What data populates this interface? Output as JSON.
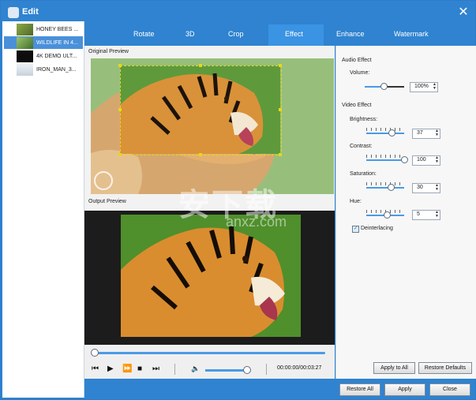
{
  "window": {
    "title": "Edit",
    "close_glyph": "✕"
  },
  "files": [
    {
      "name": "HONEY BEES ...",
      "thumb": "#6f8a3a",
      "selected": false
    },
    {
      "name": "WILDLIFE IN 4...",
      "thumb": "#77a24e",
      "selected": true
    },
    {
      "name": "4K DEMO ULT...",
      "thumb": "#0d0d0d",
      "selected": false
    },
    {
      "name": "IRON_MAN_3...",
      "thumb": "#d9e2ea",
      "selected": false
    }
  ],
  "tabs": [
    {
      "label": "Rotate"
    },
    {
      "label": "3D"
    },
    {
      "label": "Crop"
    },
    {
      "label": "Effect",
      "active": true
    },
    {
      "label": "Enhance"
    },
    {
      "label": "Watermark"
    }
  ],
  "preview": {
    "original_label": "Original Preview",
    "output_label": "Output Preview"
  },
  "playback": {
    "timecode": "00:00:00/00:03:27",
    "seek_progress": 0.01,
    "volume_level": 0.95
  },
  "audio_effect": {
    "heading": "Audio Effect",
    "volume_label": "Volume:",
    "volume_value": "100%",
    "volume_level": 0.5
  },
  "video_effect": {
    "heading": "Video Effect",
    "brightness": {
      "label": "Brightness:",
      "value": "37",
      "level": 0.68
    },
    "contrast": {
      "label": "Contrast:",
      "value": "100",
      "level": 1.0
    },
    "saturation": {
      "label": "Saturation:",
      "value": "30",
      "level": 0.65
    },
    "hue": {
      "label": "Hue:",
      "value": "5",
      "level": 0.52
    }
  },
  "deinterlacing": {
    "label": "Deinterlacing",
    "checked": true
  },
  "buttons": {
    "apply_to_all": "Apply to All",
    "restore_defaults": "Restore Defaults",
    "restore_all": "Restore All",
    "apply": "Apply",
    "close": "Close"
  },
  "watermark": {
    "main": "安下载",
    "sub": "anxz.com"
  },
  "colors": {
    "accent": "#2f83d0",
    "slider": "#4a9ae6",
    "crop_frame": "#e8d71c"
  }
}
